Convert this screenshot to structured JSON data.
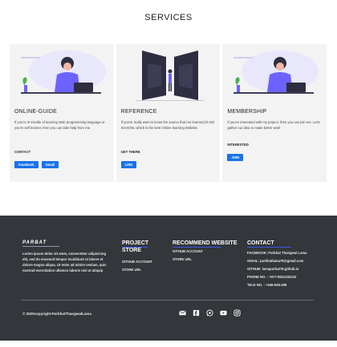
{
  "services": {
    "title": "SERVICES"
  },
  "cards": [
    {
      "title": "ONLINE-GUIDE",
      "desc": "If you're in trouble of learning Web programming language or you're self learner, then you can take help from me.",
      "label": "CONTACT",
      "buttons": [
        "Facebook",
        "Gmail"
      ]
    },
    {
      "title": "REFERENCE",
      "desc": "If you're really want to know the source that i've learned,it's W3 SCHOOL which is the best Online learning Website.",
      "label": "GET THERE",
      "buttons": [
        "LINK"
      ]
    },
    {
      "title": "MEMBERSHIP",
      "desc": "If you're interested with my project, then you can join me. Let's gather our idea to make better work",
      "label": "INTERESTED",
      "buttons": [
        "JOIN"
      ]
    }
  ],
  "footer": {
    "brand": "PARBAT",
    "about": "Lorem ipsum dolor sit amet, consectetur adipisicing elit, sed do eiusmod tempor incididunt ut labore et dolore magna aliqua. Ut enim ad minim veniam, quis nostrud exercitation ullamco laboris nisi ut aliquip",
    "project": {
      "title": "PROJECT STORE",
      "items": [
        "GITHUB ACCOUNT",
        "STORE URL"
      ]
    },
    "recommend": {
      "title": "RECOMMEND WEBSITE",
      "items": [
        "GITHUB ACCOUNT",
        "STORE URL"
      ]
    },
    "contact": {
      "title": "CONTACT",
      "items": [
        "FACEBOOK: Parbhat Thangwal Lama",
        "GMAIL: parbhatlama78@gmail.com",
        "GITHUB: lamaparbat78.github.io",
        "PHONE NO. : +977-9812332242",
        "TELE NO. : +046-548-408"
      ]
    },
    "copyright": "© 2020copyright-ParbhatThangwalLama",
    "social_icons": [
      "mail-icon",
      "facebook-icon",
      "whatsapp-icon",
      "youtube-icon",
      "instagram-icon"
    ]
  },
  "colors": {
    "accent": "#1a73e8",
    "footer_bg": "#33363b",
    "illustration_purple": "#6c63ff"
  }
}
